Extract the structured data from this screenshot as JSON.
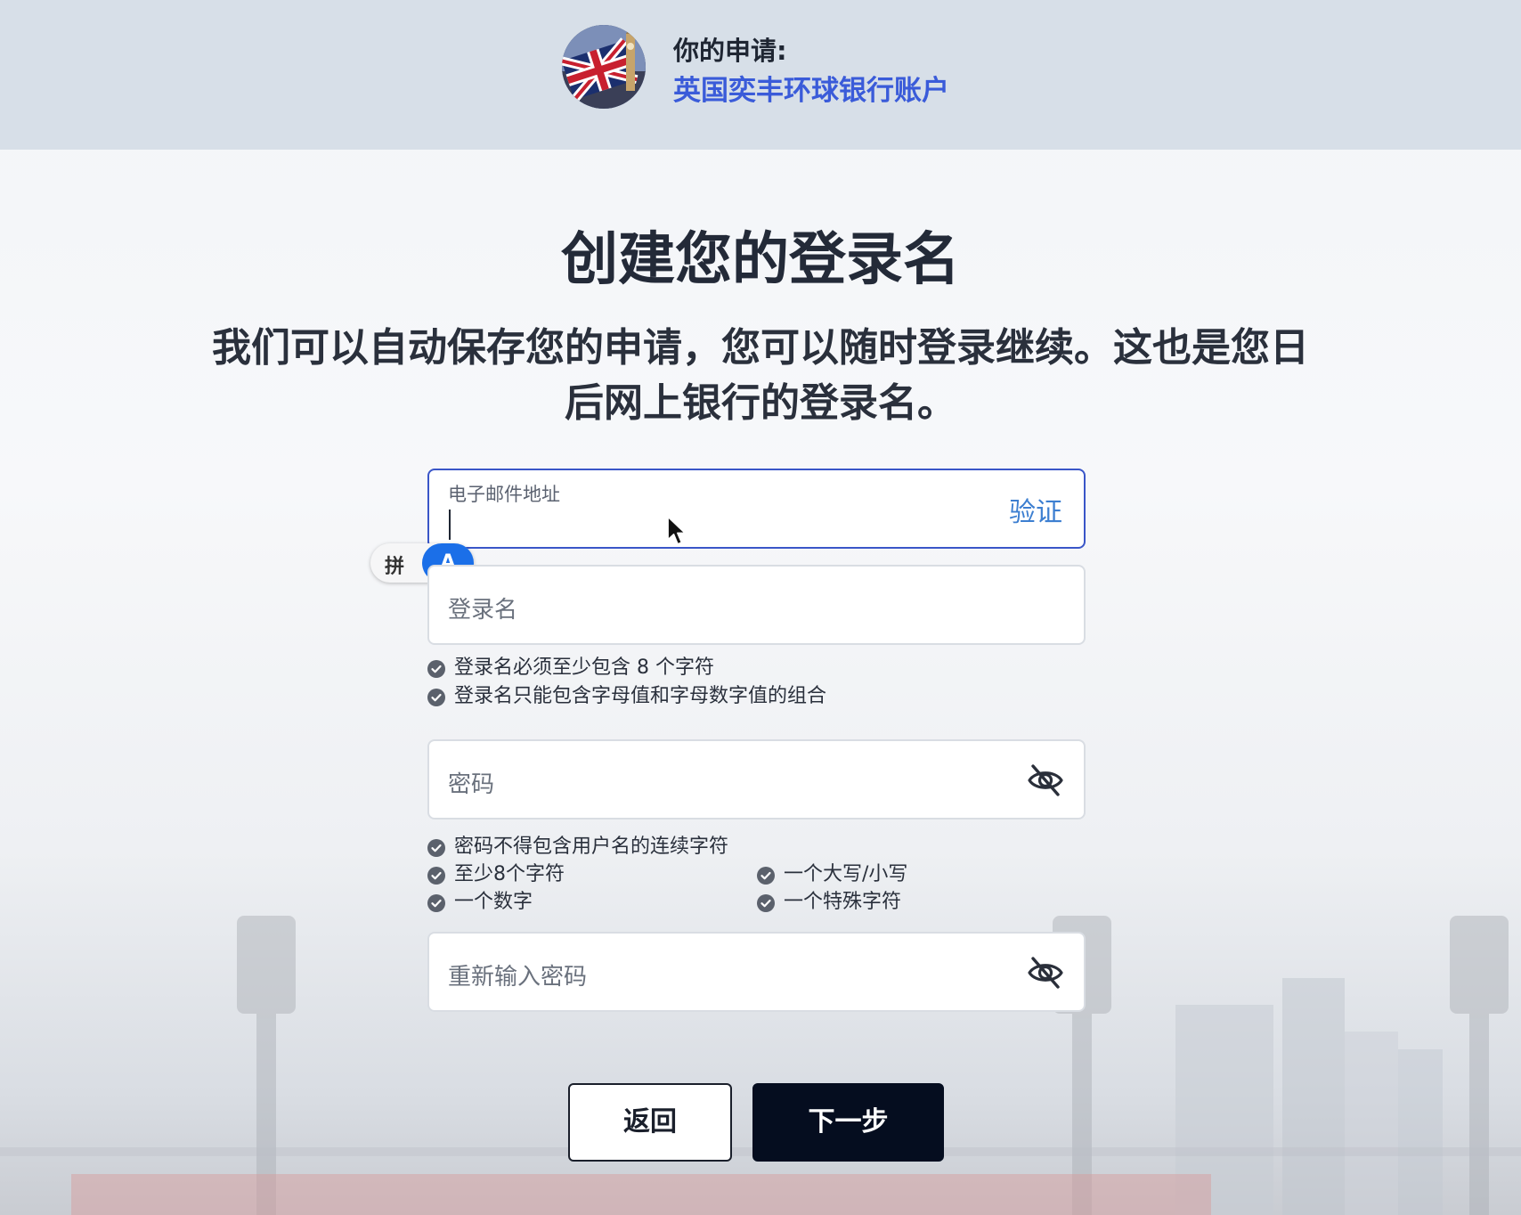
{
  "header": {
    "label": "你的申请:",
    "product": "英国奕丰环球银行账户",
    "avatar_icon": "uk-flag-big-ben-icon"
  },
  "title": "创建您的登录名",
  "subtitle_line1": "我们可以自动保存您的申请，您可以随时登录继续。这也是您日",
  "subtitle_line2": "后网上银行的登录名。",
  "email": {
    "label": "电子邮件地址",
    "value": "",
    "action": "验证"
  },
  "ime": {
    "mode_label": "拼",
    "active_label": "A"
  },
  "login": {
    "placeholder": "登录名",
    "rules": [
      "登录名必须至少包含 8 个字符",
      "登录名只能包含字母值和字母数字值的组合"
    ]
  },
  "password": {
    "placeholder": "密码",
    "toggle_icon": "eye-slash-icon",
    "rules": [
      "密码不得包含用户名的连续字符",
      "至少8个字符",
      "一个大写/小写",
      "一个数字",
      "一个特殊字符"
    ]
  },
  "repassword": {
    "placeholder": "重新输入密码",
    "toggle_icon": "eye-slash-icon"
  },
  "buttons": {
    "back": "返回",
    "next": "下一步"
  },
  "colors": {
    "header_bg": "#d7dfe8",
    "accent_blue": "#3a5bd9",
    "link_blue": "#3d7fd1",
    "focus_border": "#3a56c8",
    "primary_button": "#050d1f",
    "check_gray": "#5b616c"
  }
}
